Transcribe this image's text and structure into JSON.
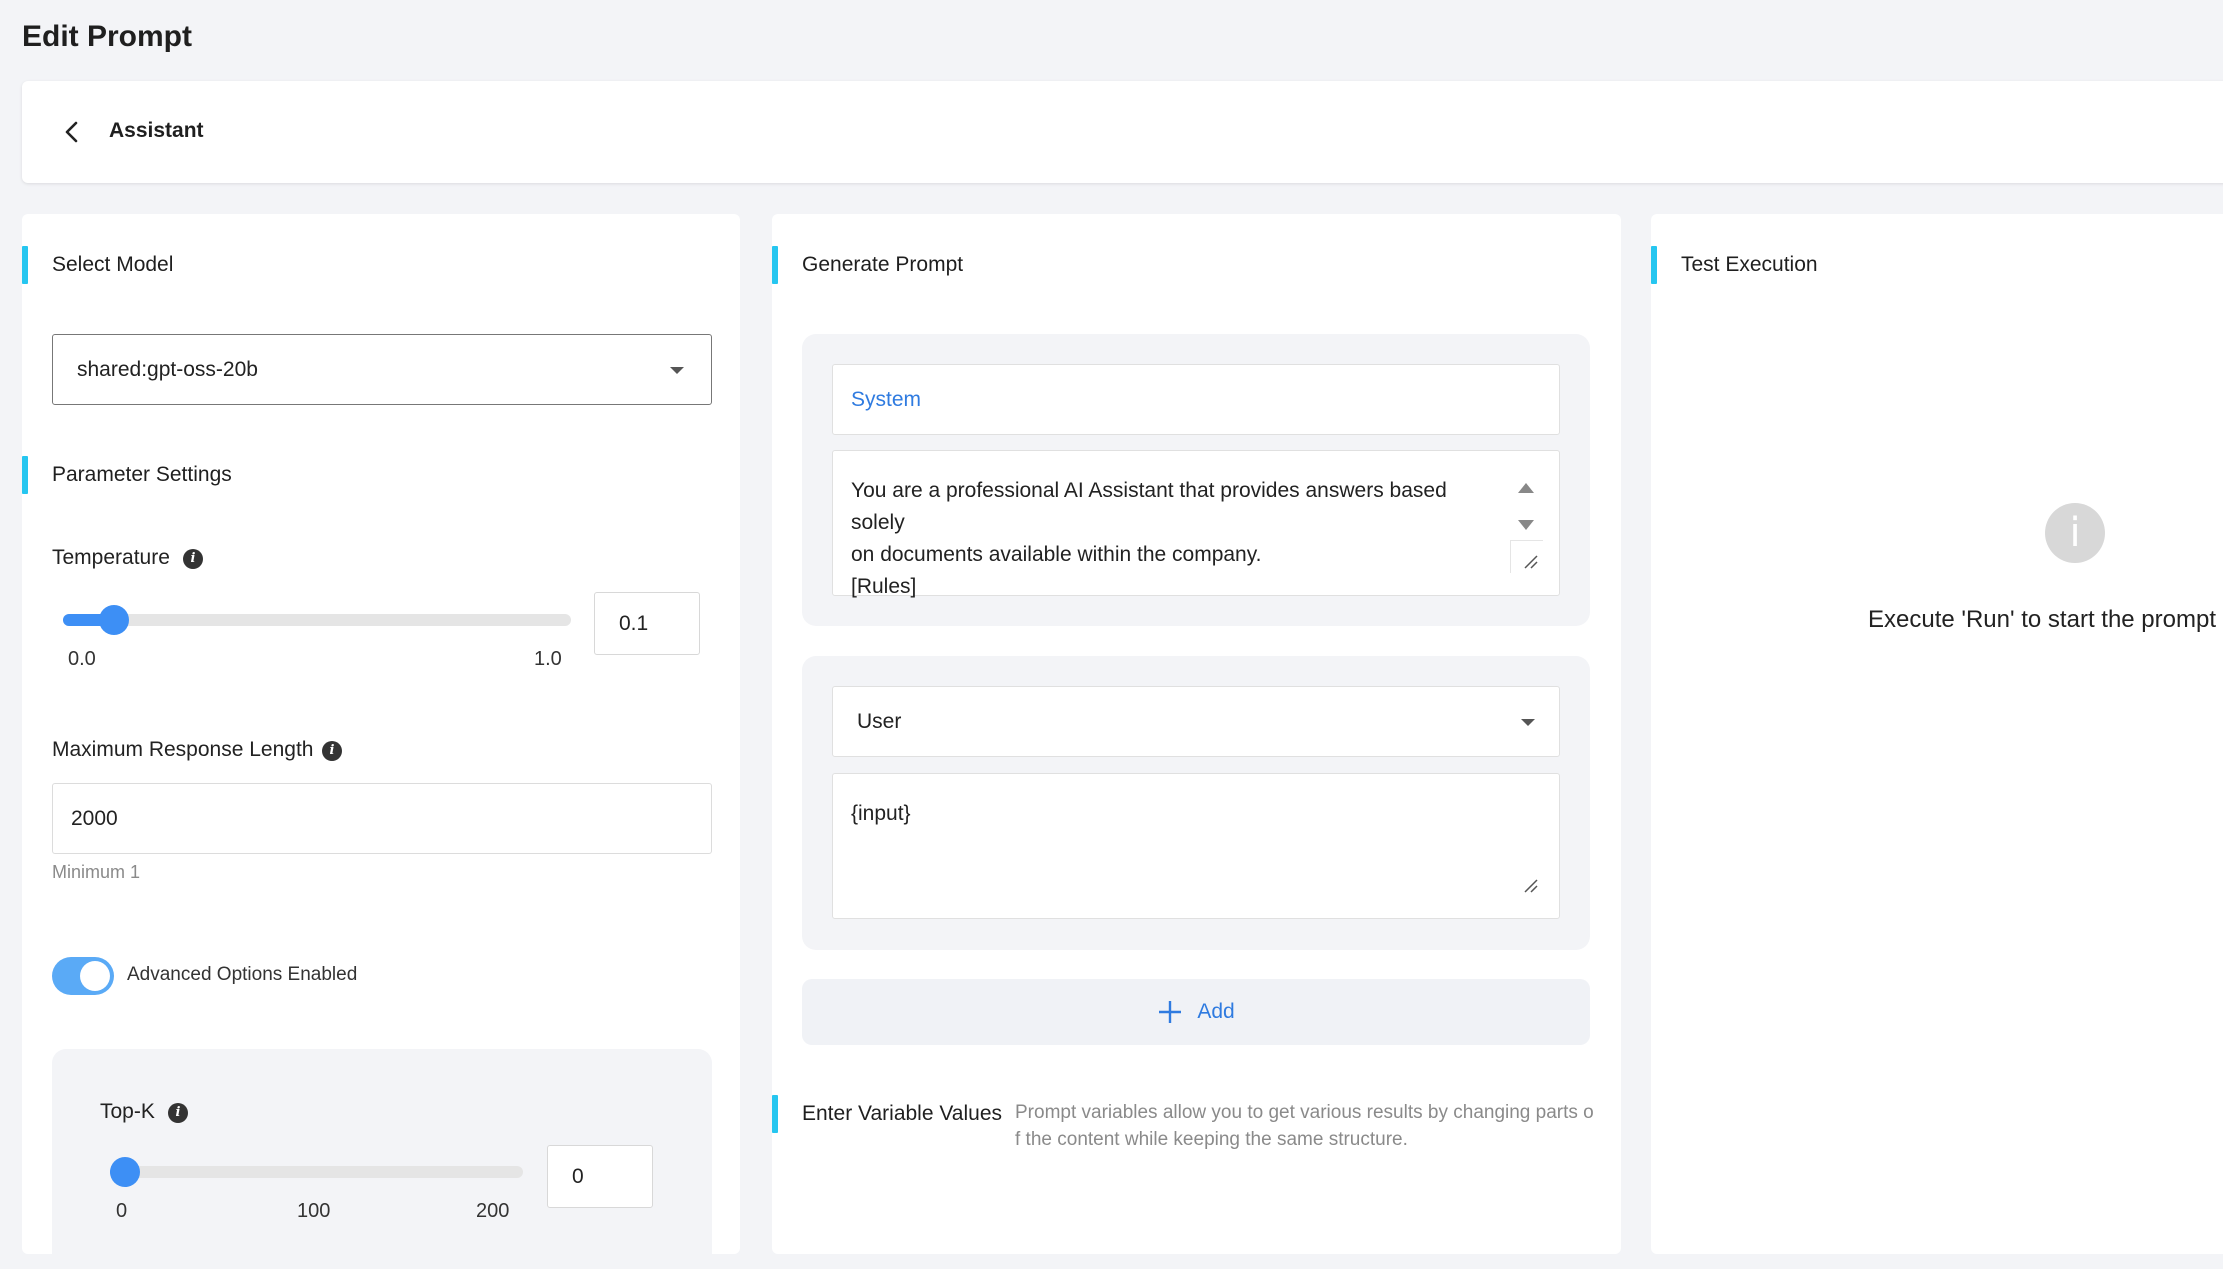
{
  "page": {
    "title": "Edit Prompt"
  },
  "header": {
    "title": "Assistant",
    "back_icon": "chevron-left-icon"
  },
  "model_panel": {
    "select_model_title": "Select Model",
    "model_value": "shared:gpt-oss-20b",
    "parameter_settings_title": "Parameter Settings",
    "temperature": {
      "label": "Temperature",
      "value": "0.1",
      "min_label": "0.0",
      "max_label": "1.0",
      "fraction": 0.1
    },
    "max_length": {
      "label": "Maximum Response Length",
      "value": "2000",
      "helper": "Minimum 1"
    },
    "advanced_toggle": {
      "label": "Advanced Options Enabled",
      "on": true
    },
    "top_k": {
      "label": "Top-K",
      "value": "0",
      "ticks": [
        "0",
        "100",
        "200"
      ],
      "fraction": 0
    }
  },
  "prompt_panel": {
    "title": "Generate Prompt",
    "system": {
      "role": "System",
      "lines": [
        "You are a professional AI Assistant that provides answers based solely",
        "on documents available within the company.",
        "[Rules]"
      ]
    },
    "user": {
      "role": "User",
      "content": "{input}"
    },
    "add_label": "Add",
    "variables": {
      "title": "Enter Variable Values",
      "description": "Prompt variables allow you to get various results by changing parts of the content while keeping the same structure."
    }
  },
  "test_panel": {
    "title": "Test Execution",
    "empty_message": "Execute 'Run' to start the prompt",
    "empty_icon": "info-icon"
  },
  "colors": {
    "accent": "#26c6f0",
    "primary": "#3d8ff5",
    "link": "#2f7be0"
  }
}
